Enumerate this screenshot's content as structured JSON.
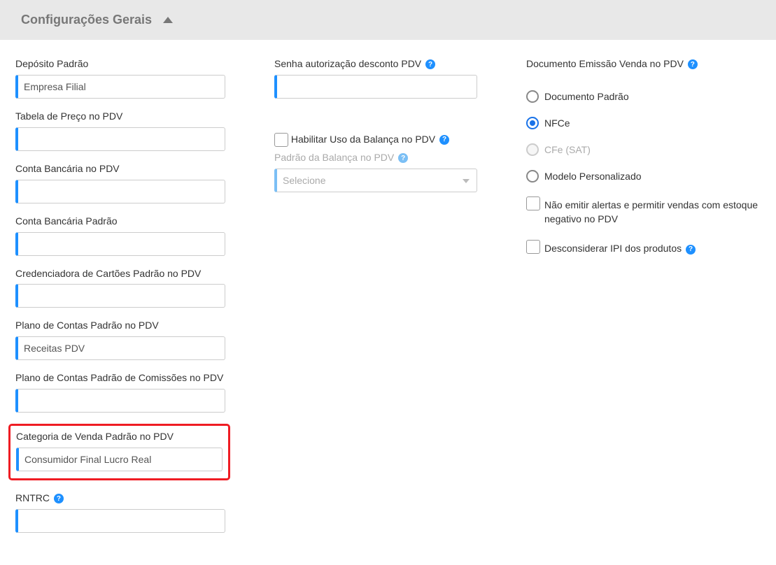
{
  "header": {
    "title": "Configurações Gerais"
  },
  "col1": {
    "deposito_padrao": {
      "label": "Depósito Padrão",
      "value": "Empresa Filial"
    },
    "tabela_preco": {
      "label": "Tabela de Preço no PDV",
      "value": ""
    },
    "conta_bancaria_pdv": {
      "label": "Conta Bancária no PDV",
      "value": ""
    },
    "conta_bancaria_padrao": {
      "label": "Conta Bancária Padrão",
      "value": ""
    },
    "credenciadora": {
      "label": "Credenciadora de Cartões Padrão no PDV",
      "value": ""
    },
    "plano_contas_pdv": {
      "label": "Plano de Contas Padrão no PDV",
      "value": "Receitas PDV"
    },
    "plano_contas_comissoes": {
      "label": "Plano de Contas Padrão de Comissões no PDV",
      "value": ""
    },
    "categoria_venda": {
      "label": "Categoria de Venda Padrão no PDV",
      "value": "Consumidor Final Lucro Real"
    },
    "rntrc": {
      "label": "RNTRC",
      "value": ""
    }
  },
  "col2": {
    "senha_desconto": {
      "label": "Senha autorização desconto PDV",
      "value": ""
    },
    "habilitar_balanca": {
      "label": "Habilitar Uso da Balança no PDV"
    },
    "padrao_balanca": {
      "label": "Padrão da Balança no PDV",
      "placeholder": "Selecione"
    }
  },
  "col3": {
    "titulo": "Documento Emissão Venda no PDV",
    "radios": {
      "documento_padrao": "Documento Padrão",
      "nfce": "NFCe",
      "cfe_sat": "CFe (SAT)",
      "modelo_personalizado": "Modelo Personalizado"
    },
    "nao_emitir_alertas": "Não emitir alertas e permitir vendas com estoque negativo no PDV",
    "desconsiderar_ipi": "Desconsiderar IPI dos produtos"
  },
  "help_glyph": "?"
}
